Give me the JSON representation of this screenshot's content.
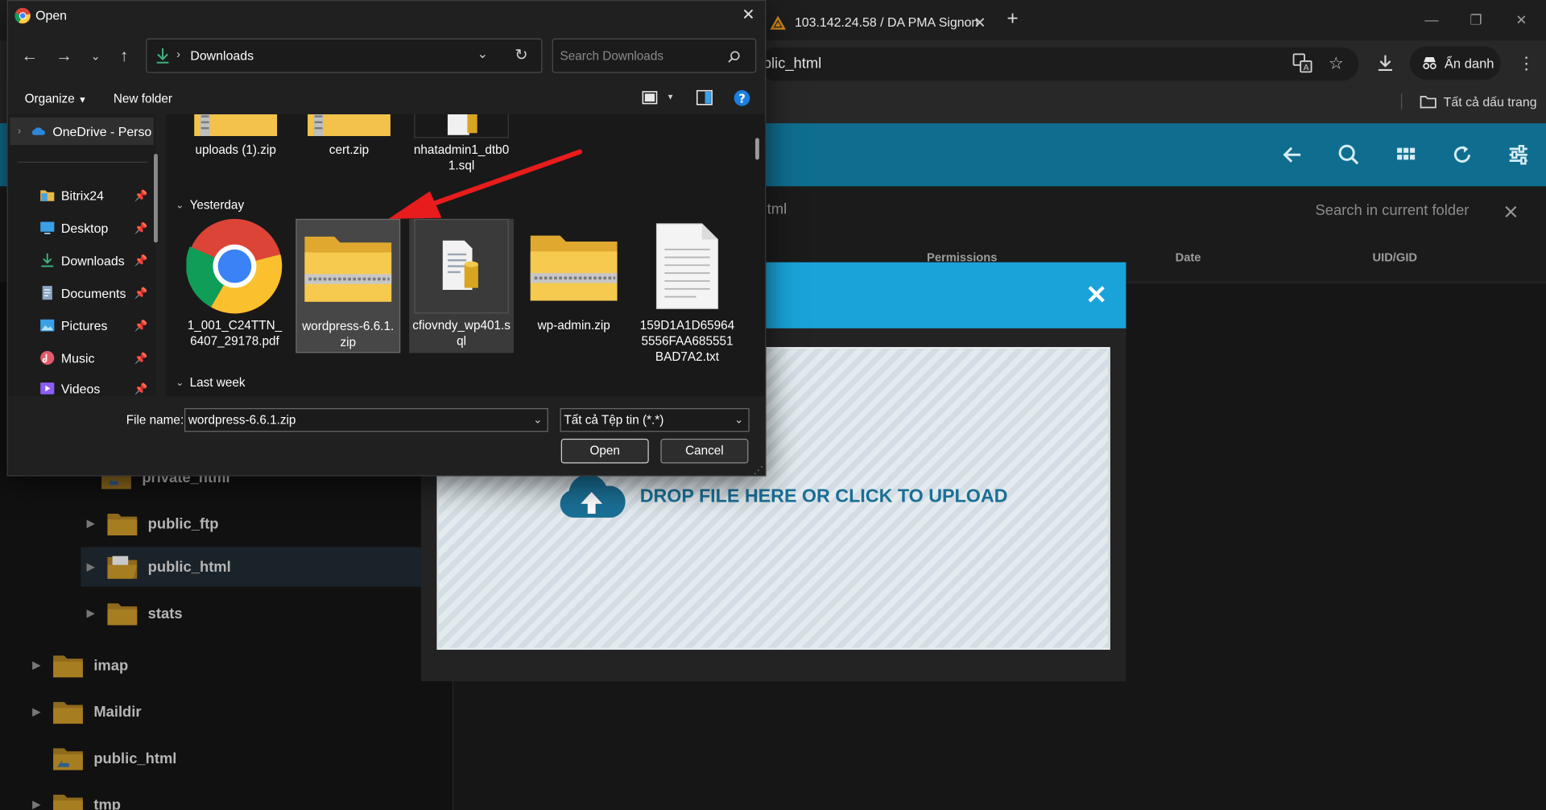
{
  "browser": {
    "tab_title": "103.142.24.58 / DA PMA Signon",
    "url_visible": "blic_html",
    "incognito_label": "Ẩn danh",
    "bookmarks_all": "Tất cả dấu trang"
  },
  "file_manager": {
    "path_fragment": "tml",
    "search_placeholder": "Search in current folder",
    "columns": [
      "Permissions",
      "Date",
      "UID/GID"
    ],
    "tree": [
      {
        "name": "private_html",
        "level": 2,
        "selected": false
      },
      {
        "name": "public_ftp",
        "level": 2,
        "selected": false
      },
      {
        "name": "public_html",
        "level": 2,
        "selected": true
      },
      {
        "name": "stats",
        "level": 2,
        "selected": false
      },
      {
        "name": "imap",
        "level": 1,
        "selected": false
      },
      {
        "name": "Maildir",
        "level": 1,
        "selected": false
      },
      {
        "name": "public_html",
        "level": 1,
        "selected": false
      },
      {
        "name": "tmp",
        "level": 1,
        "selected": false
      }
    ],
    "upload_label": "DROP FILE HERE OR CLICK TO UPLOAD",
    "colors": {
      "header": "#0f6e8f",
      "modal_header": "#1aa3d9",
      "upload_text": "#1a6f96"
    }
  },
  "dialog": {
    "title": "Open",
    "address": "Downloads",
    "search_placeholder": "Search Downloads",
    "commands": {
      "organize": "Organize",
      "new_folder": "New folder"
    },
    "nav": [
      {
        "label": "OneDrive - Perso",
        "icon": "onedrive-icon",
        "pinned": false
      },
      {
        "label": "Bitrix24",
        "icon": "folder-icon",
        "pinned": true
      },
      {
        "label": "Desktop",
        "icon": "desktop-icon",
        "pinned": true
      },
      {
        "label": "Downloads",
        "icon": "download-icon",
        "pinned": true
      },
      {
        "label": "Documents",
        "icon": "documents-icon",
        "pinned": true
      },
      {
        "label": "Pictures",
        "icon": "pictures-icon",
        "pinned": true
      },
      {
        "label": "Music",
        "icon": "music-icon",
        "pinned": true
      },
      {
        "label": "Videos",
        "icon": "videos-icon",
        "pinned": true
      }
    ],
    "groups": [
      {
        "label": "",
        "files": [
          {
            "name": "uploads (1).zip",
            "type": "zip"
          },
          {
            "name": "cert.zip",
            "type": "zip"
          },
          {
            "name": "nhatadmin1_dtb01.sql",
            "type": "sql"
          }
        ]
      },
      {
        "label": "Yesterday",
        "files": [
          {
            "name": "1_001_C24TTN_6407_29178.pdf",
            "type": "chrome"
          },
          {
            "name": "wordpress-6.6.1.zip",
            "type": "zip",
            "selected": true
          },
          {
            "name": "cfiovndy_wp401.sql",
            "type": "sql",
            "hover": true
          },
          {
            "name": "wp-admin.zip",
            "type": "zip"
          },
          {
            "name": "159D1A1D659645556FAA685551BAD7A2.txt",
            "type": "txt"
          }
        ]
      },
      {
        "label": "Last week",
        "files": []
      }
    ],
    "file_name_label": "File name:",
    "file_name_value": "wordpress-6.6.1.zip",
    "file_type": "Tất cả Tệp tin (*.*)",
    "open_label": "Open",
    "cancel_label": "Cancel"
  }
}
